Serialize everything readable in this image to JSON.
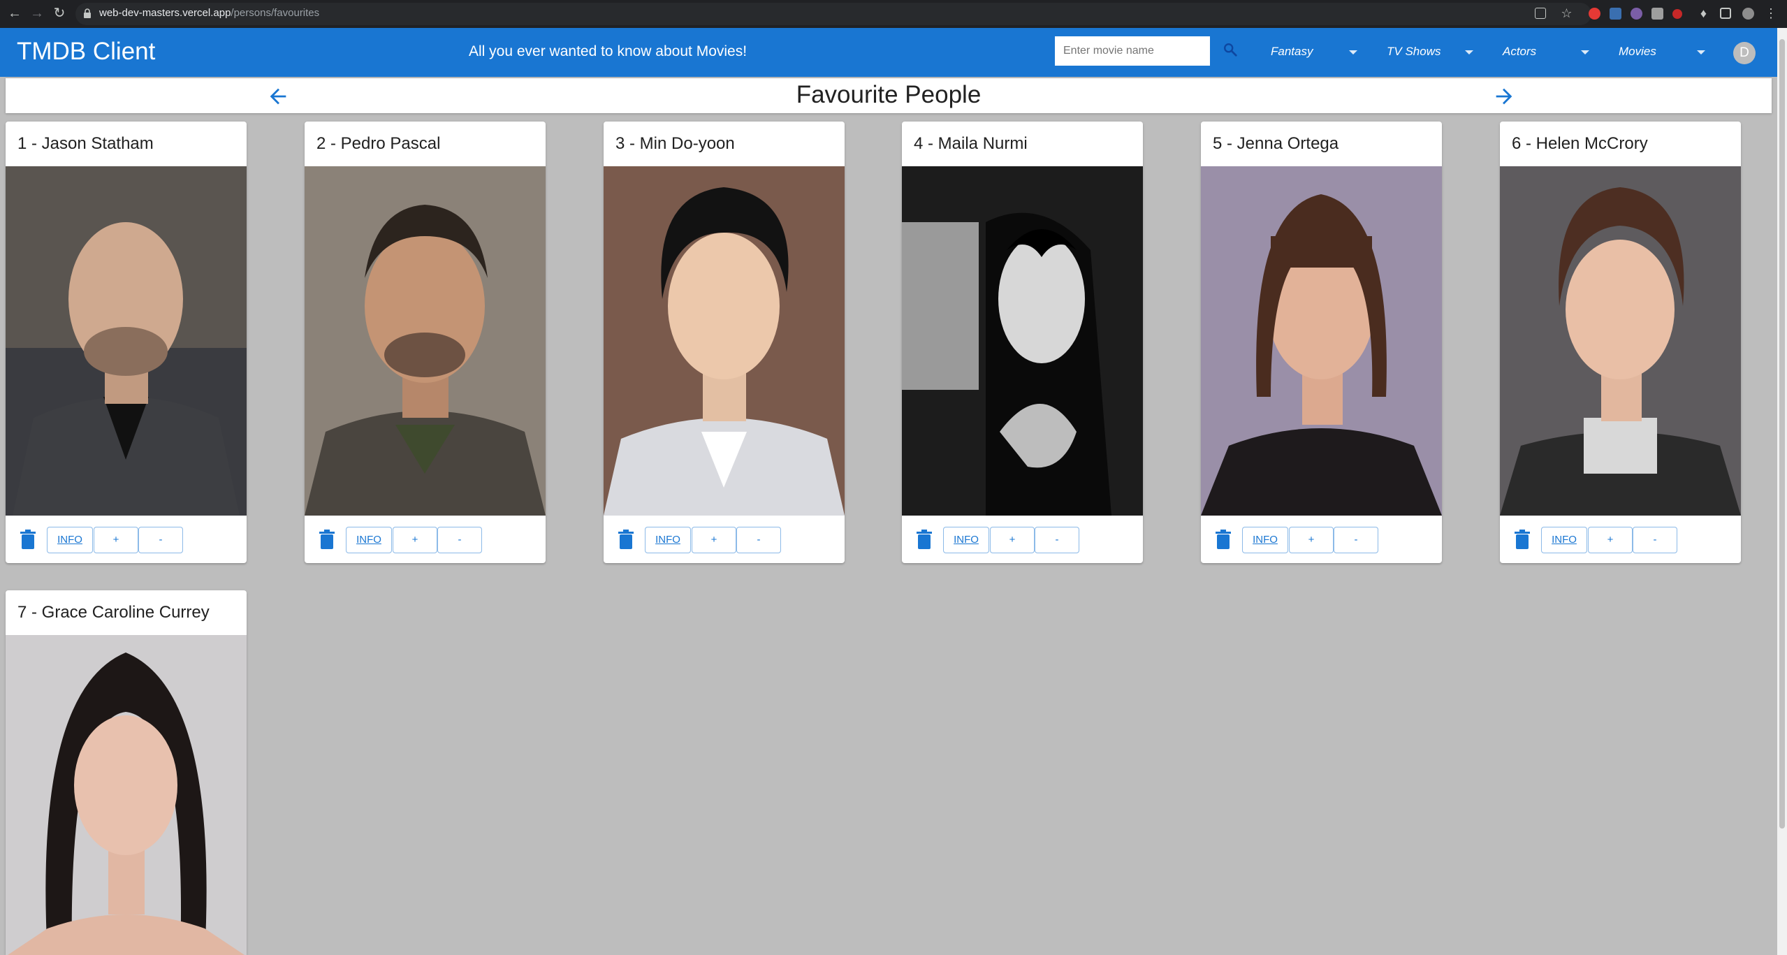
{
  "browser": {
    "url_host": "web-dev-masters.vercel.app",
    "url_path": "/persons/favourites"
  },
  "header": {
    "title": "TMDB Client",
    "tagline": "All you ever wanted to know about Movies!",
    "search_placeholder": "Enter movie name",
    "menus": [
      {
        "label": "Fantasy"
      },
      {
        "label": "TV Shows"
      },
      {
        "label": "Actors"
      },
      {
        "label": "Movies"
      }
    ],
    "avatar_initial": "D"
  },
  "page": {
    "title": "Favourite People"
  },
  "buttons": {
    "info": "INFO",
    "plus": "+",
    "minus": "-"
  },
  "people": [
    {
      "title": "1 - Jason Statham"
    },
    {
      "title": "2 - Pedro Pascal"
    },
    {
      "title": "3 - Min Do-yoon"
    },
    {
      "title": "4 - Maila Nurmi"
    },
    {
      "title": "5 - Jenna Ortega"
    },
    {
      "title": "6 - Helen McCrory"
    },
    {
      "title": "7 - Grace Caroline Currey"
    }
  ],
  "colors": {
    "brand": "#1976d2",
    "background": "#bdbdbd"
  }
}
